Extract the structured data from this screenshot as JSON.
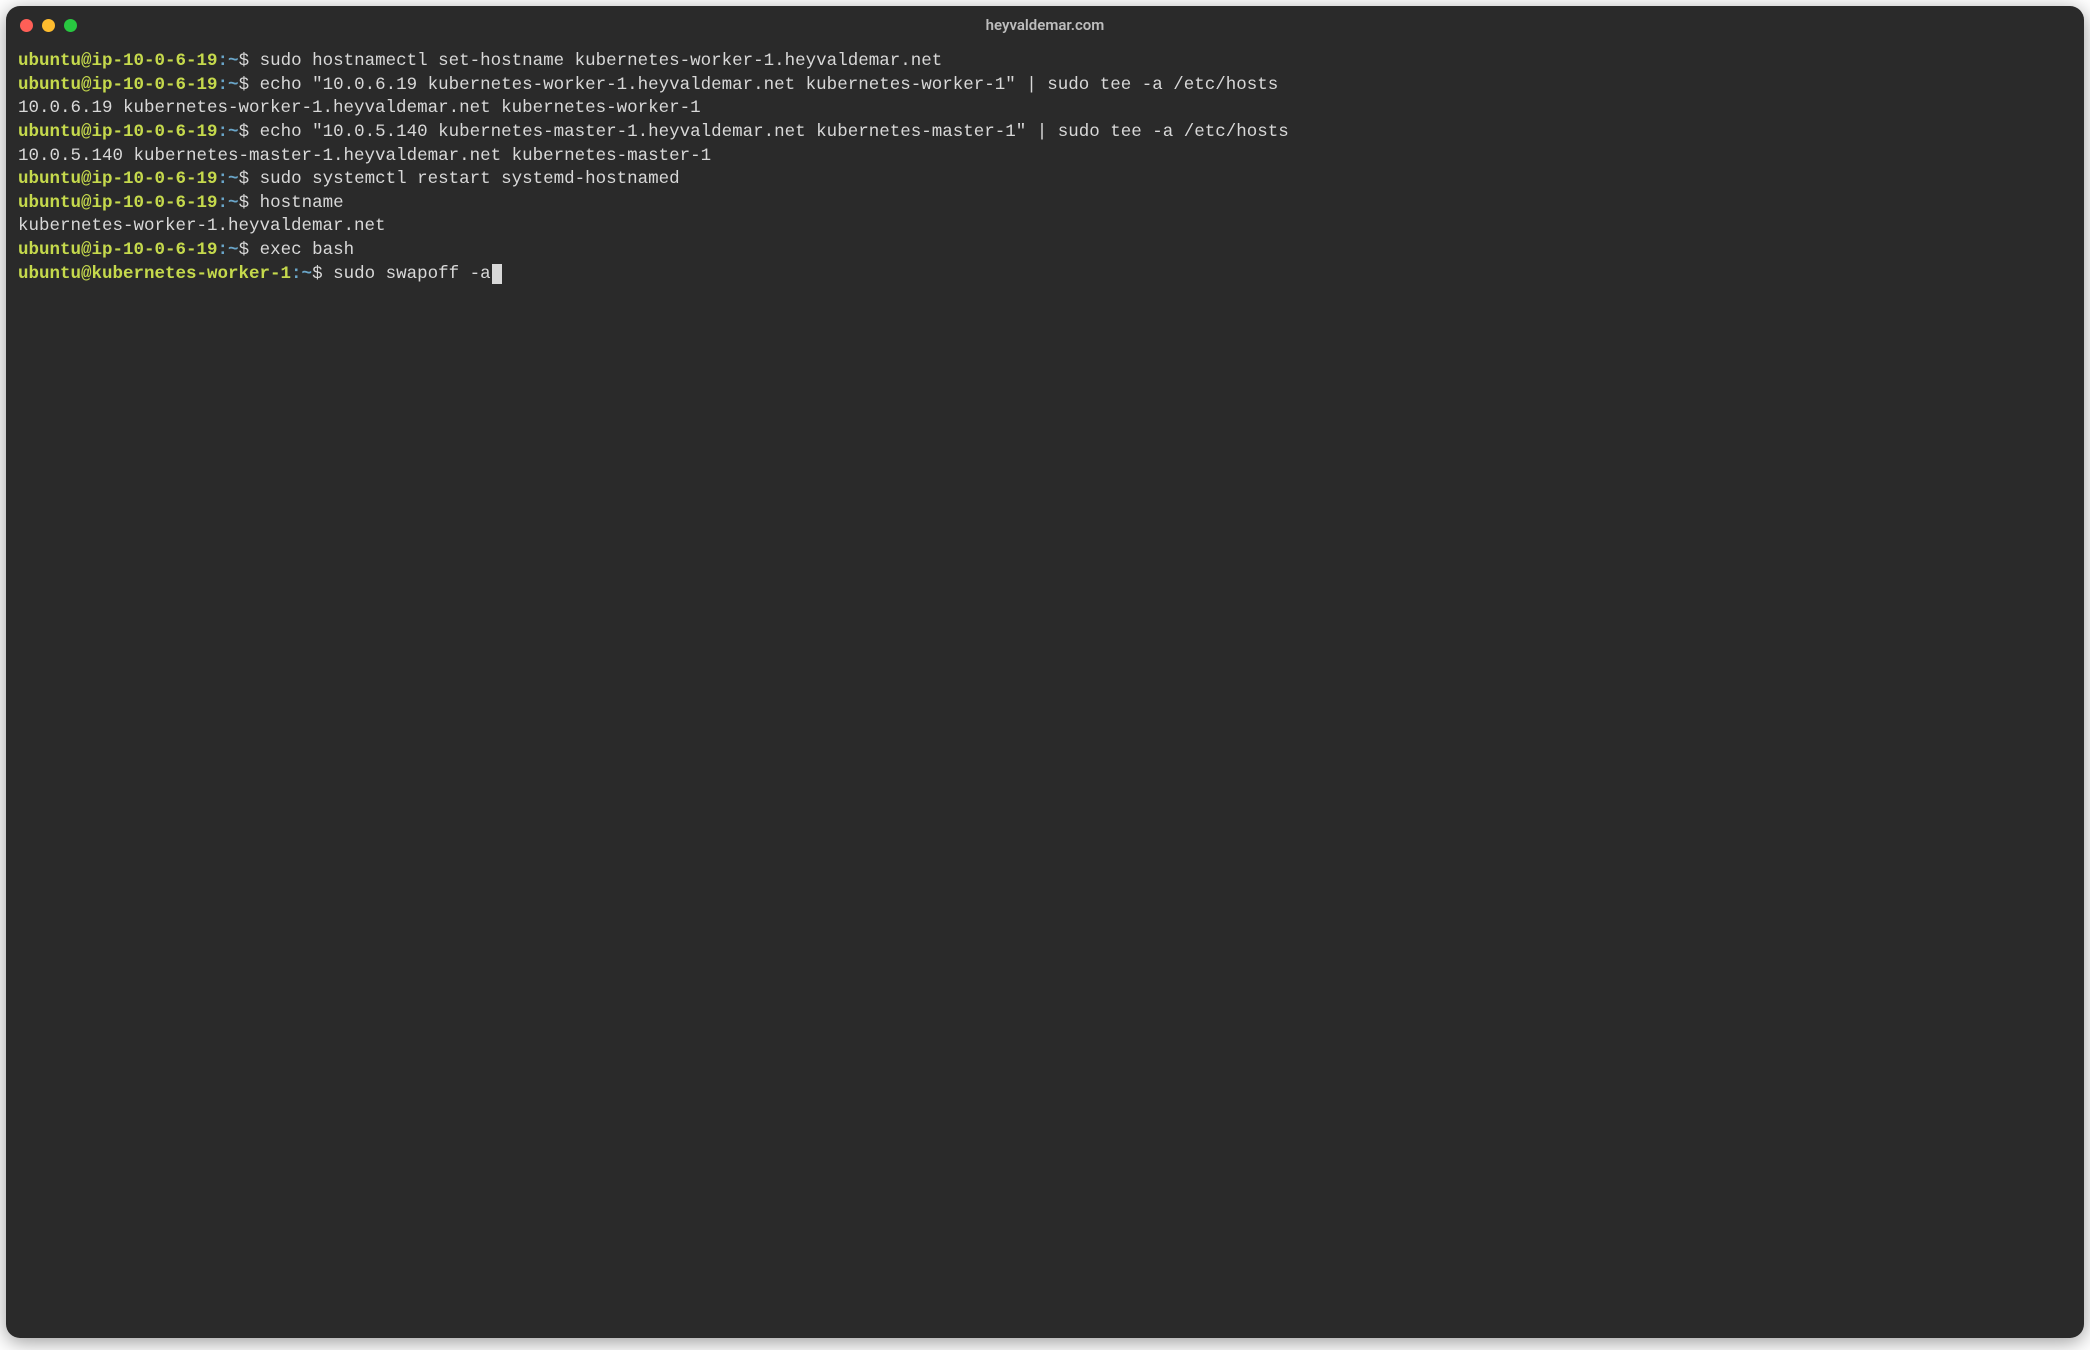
{
  "window": {
    "title": "heyvaldemar.com"
  },
  "colors": {
    "bg": "#2a2a2a",
    "fg": "#d8d8d8",
    "user": "#c5d94c",
    "path": "#6aa6c9",
    "red": "#ff5f57",
    "yellow": "#febc2e",
    "green": "#28c840"
  },
  "lines": [
    {
      "prompt_user": "ubuntu@ip-10-0-6-19",
      "prompt_path": ":~",
      "dollar": "$",
      "cmd": "sudo hostnamectl set-hostname kubernetes-worker-1.heyvaldemar.net"
    },
    {
      "prompt_user": "ubuntu@ip-10-0-6-19",
      "prompt_path": ":~",
      "dollar": "$",
      "cmd": "echo \"10.0.6.19 kubernetes-worker-1.heyvaldemar.net kubernetes-worker-1\" | sudo tee -a /etc/hosts"
    },
    {
      "output": "10.0.6.19 kubernetes-worker-1.heyvaldemar.net kubernetes-worker-1"
    },
    {
      "prompt_user": "ubuntu@ip-10-0-6-19",
      "prompt_path": ":~",
      "dollar": "$",
      "cmd": "echo \"10.0.5.140 kubernetes-master-1.heyvaldemar.net kubernetes-master-1\" | sudo tee -a /etc/hosts"
    },
    {
      "output": "10.0.5.140 kubernetes-master-1.heyvaldemar.net kubernetes-master-1"
    },
    {
      "prompt_user": "ubuntu@ip-10-0-6-19",
      "prompt_path": ":~",
      "dollar": "$",
      "cmd": "sudo systemctl restart systemd-hostnamed"
    },
    {
      "prompt_user": "ubuntu@ip-10-0-6-19",
      "prompt_path": ":~",
      "dollar": "$",
      "cmd": "hostname"
    },
    {
      "output": "kubernetes-worker-1.heyvaldemar.net"
    },
    {
      "prompt_user": "ubuntu@ip-10-0-6-19",
      "prompt_path": ":~",
      "dollar": "$",
      "cmd": "exec bash"
    },
    {
      "prompt_user": "ubuntu@kubernetes-worker-1",
      "prompt_path": ":~",
      "dollar": "$",
      "cmd": "sudo swapoff -a",
      "cursor": true
    }
  ]
}
